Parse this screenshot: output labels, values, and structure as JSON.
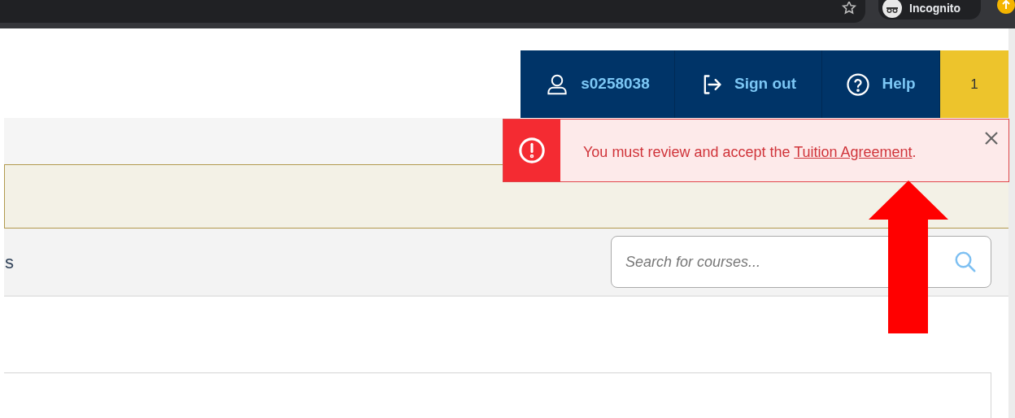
{
  "browser": {
    "profile_label": "Incognito"
  },
  "nav": {
    "items": [
      {
        "kind": "user",
        "label": "s0258038"
      },
      {
        "kind": "sign_out",
        "label": "Sign out"
      },
      {
        "kind": "help",
        "label": "Help"
      }
    ],
    "badge": "1"
  },
  "alert": {
    "text_before": "You must review and accept the ",
    "link": "Tuition Agreement",
    "text_after": "."
  },
  "toolbar": {
    "text_partial": "s",
    "search": {
      "placeholder": "Search for courses..."
    }
  }
}
